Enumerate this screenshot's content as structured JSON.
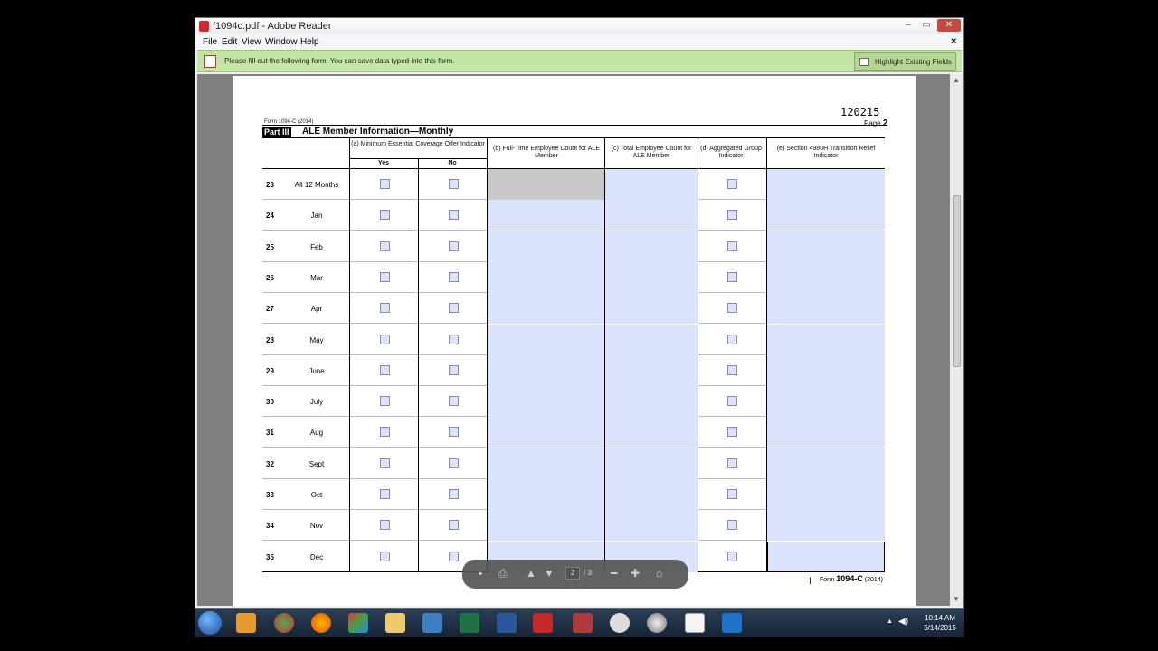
{
  "window": {
    "title": "f1094c.pdf - Adobe Reader",
    "controls": {
      "minimize": "–",
      "maximize": "▭",
      "close": "✕"
    }
  },
  "menu": {
    "items": [
      "File",
      "Edit",
      "View",
      "Window",
      "Help"
    ],
    "doc_close": "×"
  },
  "notice": {
    "text": "Please fill out the following form. You can save data typed into this form.",
    "highlight_button": "Highlight Existing Fields"
  },
  "form": {
    "code": "120215",
    "page_label": "Page",
    "page_number": "2",
    "header": "Form 1094-C (2014)",
    "part_label": "Part III",
    "part_title": "ALE Member Information—Monthly",
    "col_a": "(a) Minimum Essential Coverage Offer Indicator",
    "col_a_yes": "Yes",
    "col_a_no": "No",
    "col_b": "(b) Full-Time Employee Count for ALE Member",
    "col_c": "(c) Total Employee Count for ALE Member",
    "col_d": "(d) Aggregated Group Indicator",
    "col_e": "(e) Section 4980H Transition Relief Indicator",
    "rows": [
      {
        "num": "23",
        "label": "All 12 Months"
      },
      {
        "num": "24",
        "label": "Jan"
      },
      {
        "num": "25",
        "label": "Feb"
      },
      {
        "num": "26",
        "label": "Mar"
      },
      {
        "num": "27",
        "label": "Apr"
      },
      {
        "num": "28",
        "label": "May"
      },
      {
        "num": "29",
        "label": "June"
      },
      {
        "num": "30",
        "label": "July"
      },
      {
        "num": "31",
        "label": "Aug"
      },
      {
        "num": "32",
        "label": "Sept"
      },
      {
        "num": "33",
        "label": "Oct"
      },
      {
        "num": "34",
        "label": "Nov"
      },
      {
        "num": "35",
        "label": "Dec"
      }
    ],
    "footer_form": "Form",
    "footer_code": "1094-C",
    "footer_year": "(2014)"
  },
  "navbar": {
    "current_page": "2",
    "total": "/ 3"
  },
  "taskbar": {
    "time": "10:14 AM",
    "date": "5/14/2015"
  }
}
